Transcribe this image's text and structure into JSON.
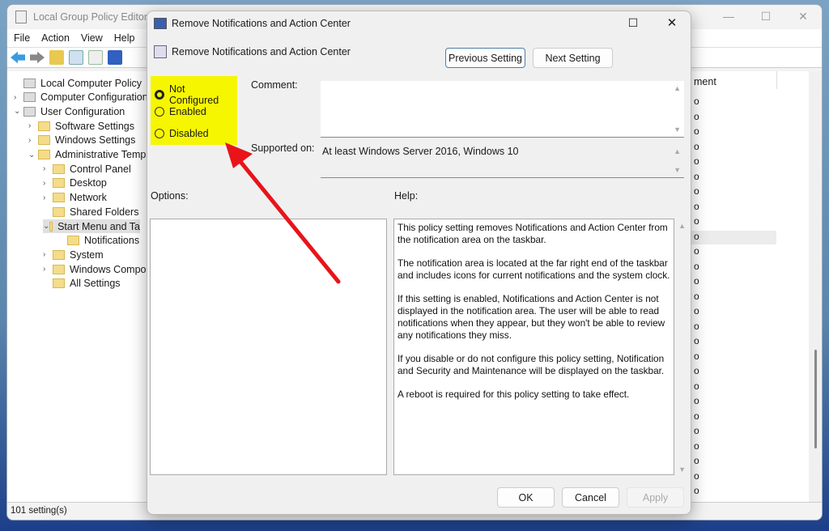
{
  "main": {
    "title": "Local Group Policy Editor",
    "menu": [
      "File",
      "Action",
      "View",
      "Help"
    ],
    "tree": [
      {
        "label": "Local Computer Policy",
        "level": 0,
        "chev": ""
      },
      {
        "label": "Computer Configuration",
        "level": 0,
        "chev": ">"
      },
      {
        "label": "User Configuration",
        "level": 0,
        "chev": "v"
      },
      {
        "label": "Software Settings",
        "level": 1,
        "chev": ">"
      },
      {
        "label": "Windows Settings",
        "level": 1,
        "chev": ">"
      },
      {
        "label": "Administrative Templ",
        "level": 1,
        "chev": "v"
      },
      {
        "label": "Control Panel",
        "level": 2,
        "chev": ">"
      },
      {
        "label": "Desktop",
        "level": 2,
        "chev": ">"
      },
      {
        "label": "Network",
        "level": 2,
        "chev": ">"
      },
      {
        "label": "Shared Folders",
        "level": 2,
        "chev": ""
      },
      {
        "label": "Start Menu and Ta",
        "level": 2,
        "chev": "v"
      },
      {
        "label": "Notifications",
        "level": 3,
        "chev": ""
      },
      {
        "label": "System",
        "level": 2,
        "chev": ">"
      },
      {
        "label": "Windows Compo",
        "level": 2,
        "chev": ">"
      },
      {
        "label": "All Settings",
        "level": 2,
        "chev": ""
      }
    ],
    "list_header": "ment",
    "list_value": "o",
    "status": "101 setting(s)"
  },
  "dialog": {
    "title": "Remove Notifications and Action Center",
    "setting_name": "Remove Notifications and Action Center",
    "prev": "Previous Setting",
    "next": "Next Setting",
    "options": [
      "Not Configured",
      "Enabled",
      "Disabled"
    ],
    "selected": "Not Configured",
    "comment_label": "Comment:",
    "supported_label": "Supported on:",
    "supported_value": "At least Windows Server 2016, Windows 10",
    "options_label": "Options:",
    "help_label": "Help:",
    "help": [
      "This policy setting removes Notifications and Action Center from the notification area on the taskbar.",
      "The notification area is located at the far right end of the taskbar and includes icons for current notifications and the system clock.",
      "If this setting is enabled, Notifications and Action Center is not displayed in the notification area. The user will be able to read notifications when they appear, but they won't be able to review any notifications they miss.",
      "If you disable or do not configure this policy setting, Notification and Security and Maintenance will be displayed on the taskbar.",
      "A reboot is required for this policy setting to take effect."
    ],
    "ok": "OK",
    "cancel": "Cancel",
    "apply": "Apply"
  },
  "colors": {
    "highlight": "#f6f600",
    "arrow": "#e8141a"
  }
}
